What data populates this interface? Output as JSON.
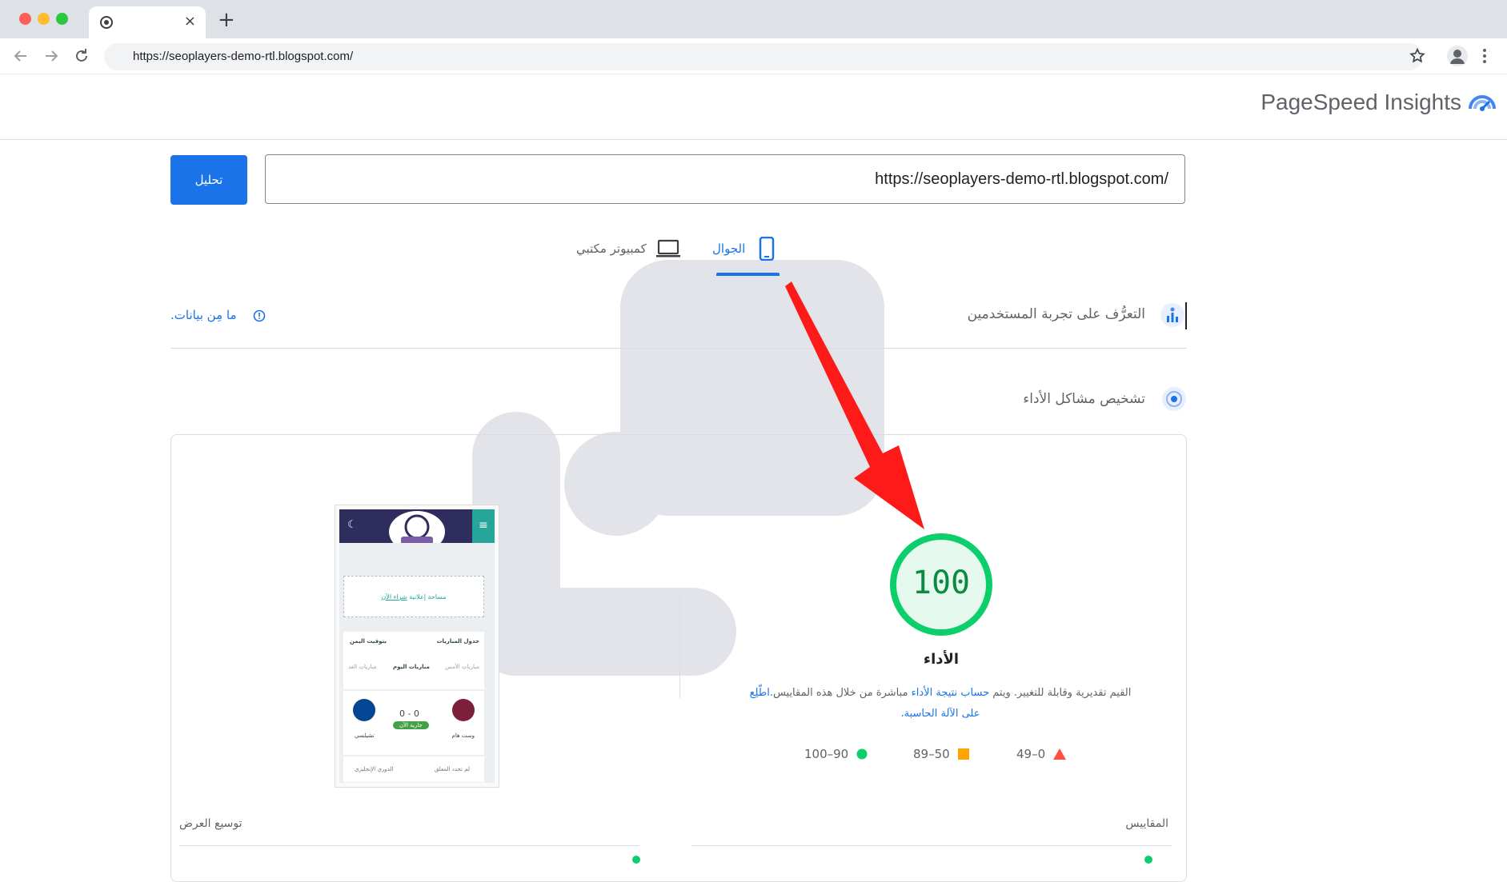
{
  "browser": {
    "tab_title": "",
    "tab_close": "×",
    "new_tab": "+",
    "url": "https://seoplayers-demo-rtl.blogspot.com/"
  },
  "header": {
    "title": "PageSpeed Insights"
  },
  "search": {
    "url_value": "https://seoplayers-demo-rtl.blogspot.com/",
    "analyze_label": "تحليل"
  },
  "device_tabs": {
    "mobile": "الجوال",
    "desktop": "كمبيوتر مكتبي"
  },
  "sections": {
    "ux_title": "التعرُّف على تجربة المستخدمين",
    "no_data": "ما مِن بيانات.",
    "diagnose_title": "تشخيص مشاكل الأداء"
  },
  "performance": {
    "score": "100",
    "score_value": 100,
    "title": "الأداء",
    "desc_part1": "القيم تقديرية وقابلة للتغيير. ويتم ",
    "desc_link1": "حساب نتيجة الأداء",
    "desc_part2": " مباشرة من خلال هذه المقاييس.",
    "desc_link2": "اطّلِع على الآلة الحاسبة.",
    "legend": {
      "good": "100–90",
      "average": "89–50",
      "poor": "49–0"
    }
  },
  "phone_preview": {
    "ad_text": "مساحة إعلانية",
    "ad_link": "شراء الآن",
    "table_title": "جدول المباريات",
    "tz_label": "بتوقيت اليمن",
    "tabs": [
      "مباريات الأمس",
      "مباريات اليوم",
      "مباريات الغد"
    ],
    "score": "0 - 0",
    "status": "جارية الآن",
    "team_home": "وست هام",
    "team_away": "تشيلسي",
    "league": "الدوري الإنجليزي",
    "channel": "لم تحدد المعلق"
  },
  "bottom": {
    "metrics_label": "المقاييس",
    "expand_label": "توسيع العرض"
  },
  "colors": {
    "accent": "#1a73e8",
    "good": "#0cce6b",
    "average": "#ffa400",
    "poor": "#ff4e42",
    "arrow": "#ff1a1a"
  }
}
